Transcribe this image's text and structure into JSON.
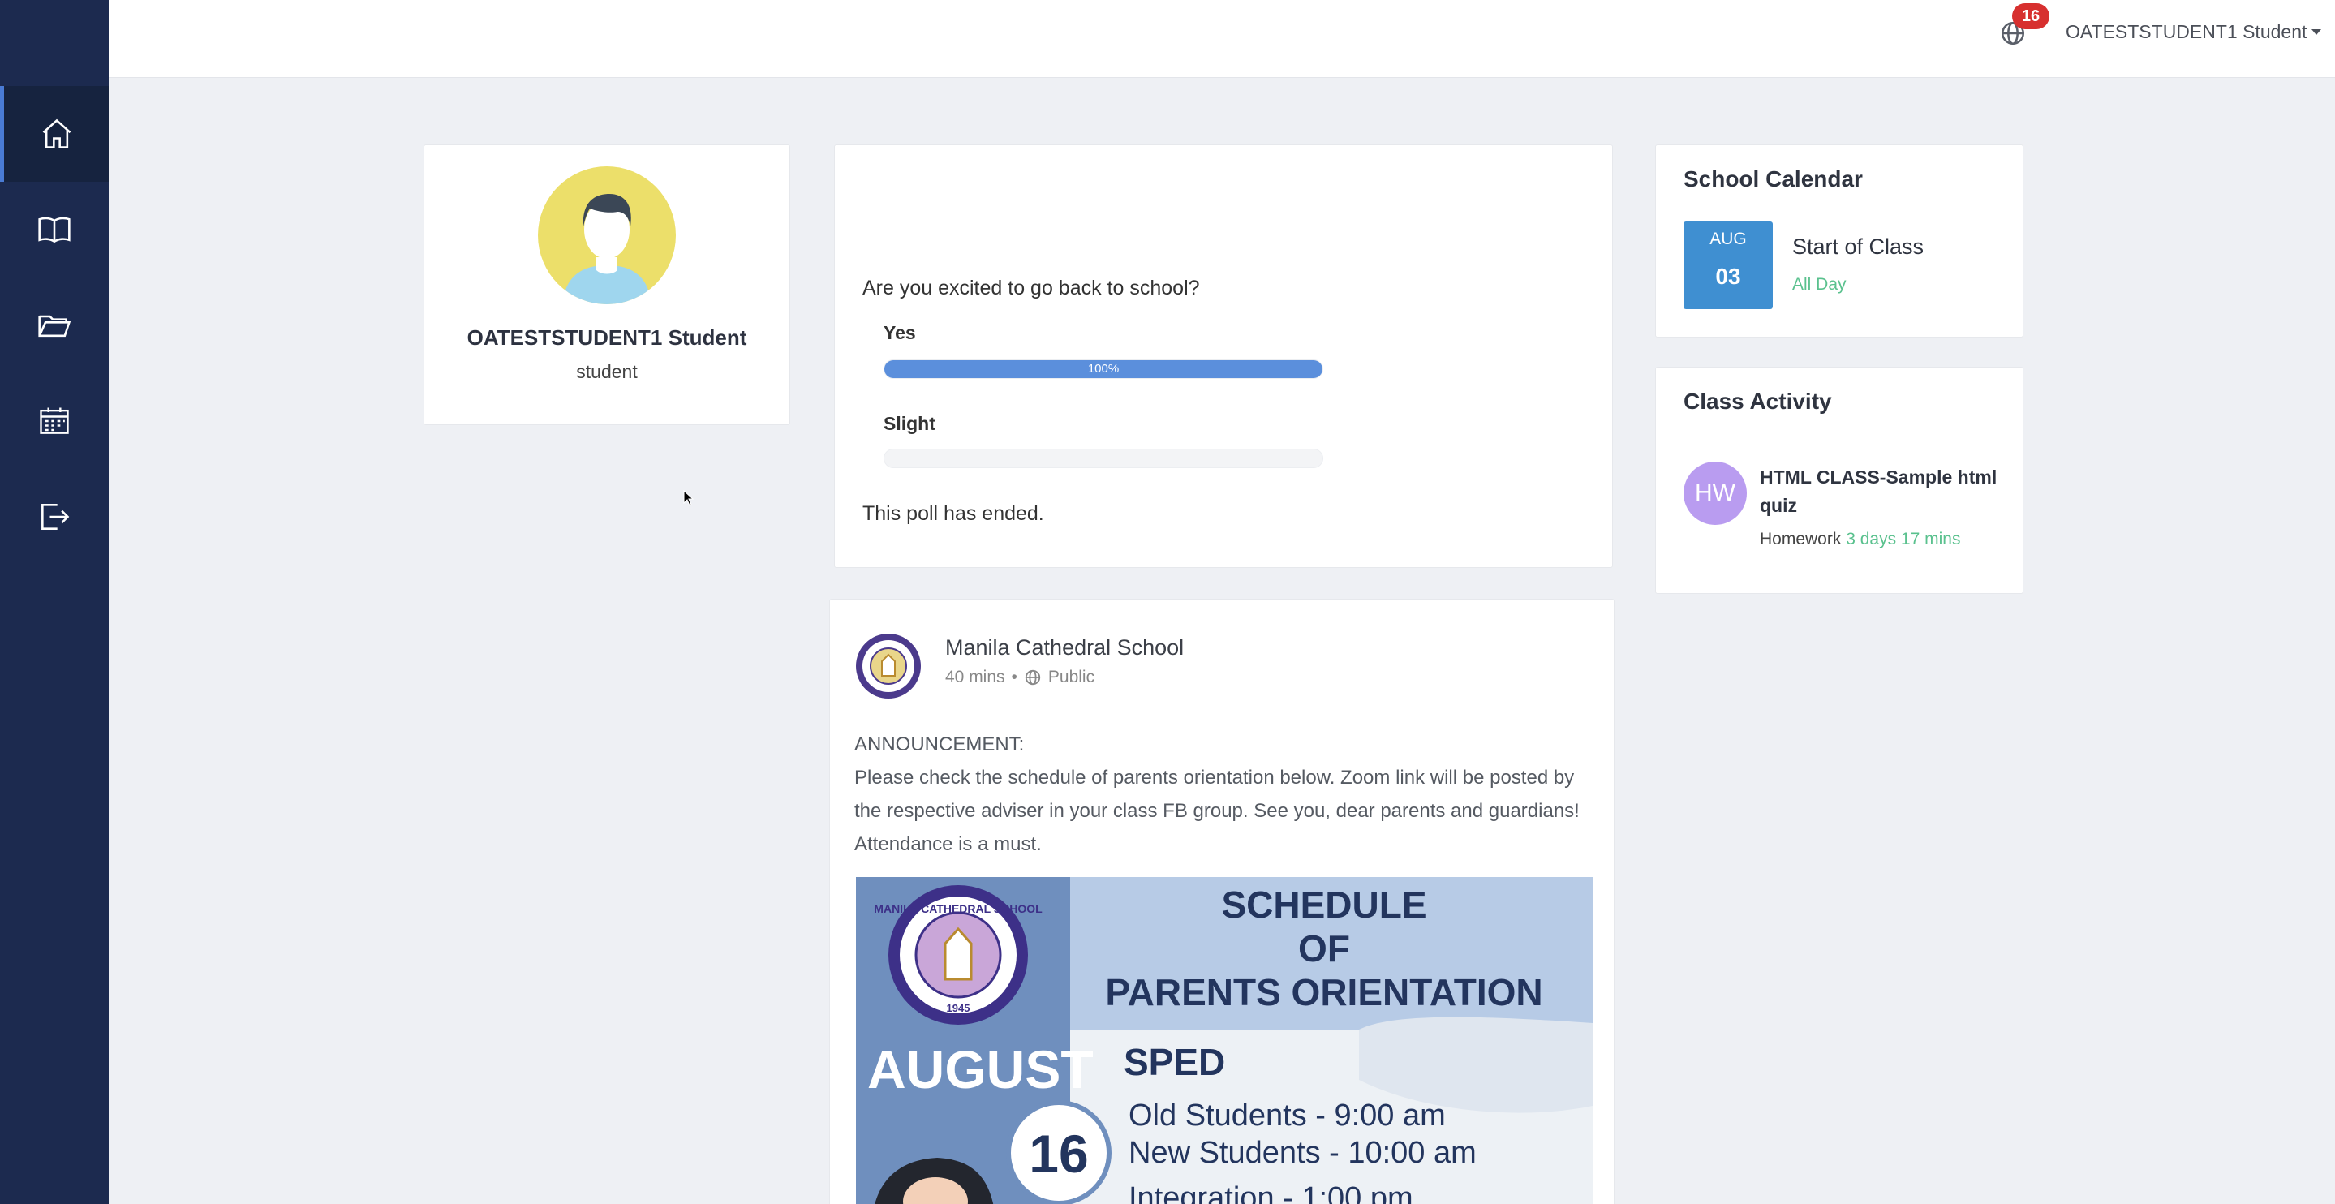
{
  "sidebar": {
    "items": [
      {
        "name": "home",
        "icon": "home-icon",
        "active": true
      },
      {
        "name": "courses",
        "icon": "book-icon",
        "active": false
      },
      {
        "name": "files",
        "icon": "folder-icon",
        "active": false
      },
      {
        "name": "calendar",
        "icon": "calendar-icon",
        "active": false
      },
      {
        "name": "logout",
        "icon": "logout-icon",
        "active": false
      }
    ]
  },
  "header": {
    "notification_count": "16",
    "user_name": "OATESTSTUDENT1 Student"
  },
  "profile": {
    "name": "OATESTSTUDENT1 Student",
    "role": "student"
  },
  "poll": {
    "question": "Are you excited to go back to school?",
    "options": [
      {
        "label": "Yes",
        "percent_text": "100%",
        "fraction": 1.0
      },
      {
        "label": "Slight",
        "percent_text": "",
        "fraction": 0.0
      }
    ],
    "status": "This poll has ended."
  },
  "post": {
    "author": "Manila Cathedral School",
    "time": "40 mins",
    "separator": "•",
    "visibility": "Public",
    "text_lines": [
      "ANNOUNCEMENT:",
      "Please check the schedule of parents orientation below. Zoom link will be posted by",
      "the respective adviser in your class FB group. See you, dear parents and guardians!",
      "Attendance is a must."
    ],
    "image": {
      "title_lines": [
        "SCHEDULE",
        "OF",
        "PARENTS ORIENTATION"
      ],
      "month": "AUGUST",
      "day": "16",
      "category": "SPED",
      "schedule": [
        "Old Students - 9:00 am",
        "New Students - 10:00 am",
        "Integration - 1:00 pm"
      ],
      "seal_text": "MANILA CATHEDRAL SCHOOL",
      "seal_year": "1945"
    }
  },
  "calendar": {
    "title": "School Calendar",
    "event": {
      "month": "AUG",
      "day": "03",
      "title": "Start of Class",
      "subtitle": "All Day"
    }
  },
  "activity": {
    "title": "Class Activity",
    "item": {
      "initials": "HW",
      "title": "HTML CLASS-Sample html quiz",
      "type": "Homework",
      "time": "3 days 17 mins"
    }
  },
  "colors": {
    "sidebar": "#1c2a4f",
    "accent": "#5b8fdc",
    "badge": "#d7302f",
    "success": "#5ac18e",
    "calendar_box": "#3f8fd1",
    "hw_avatar": "#b99cf0"
  }
}
